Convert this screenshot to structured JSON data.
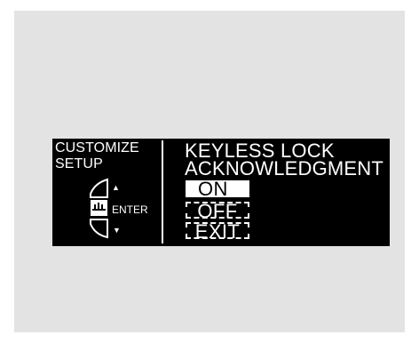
{
  "left_panel": {
    "title_line1": "CUSTOMIZE",
    "title_line2": "SETUP",
    "up_icon": "▲",
    "enter_label": "ENTER",
    "down_icon": "▼"
  },
  "right_panel": {
    "title_line1": "KEYLESS LOCK",
    "title_line2": "ACKNOWLEDGMENT",
    "options": [
      {
        "label": "ON",
        "selected": true
      },
      {
        "label": "OFF",
        "selected": false
      },
      {
        "label": "EXIT",
        "selected": false
      }
    ]
  },
  "colors": {
    "screen_background": "#000000",
    "text": "#ffffff",
    "frame_background": "#e3e3e3"
  }
}
